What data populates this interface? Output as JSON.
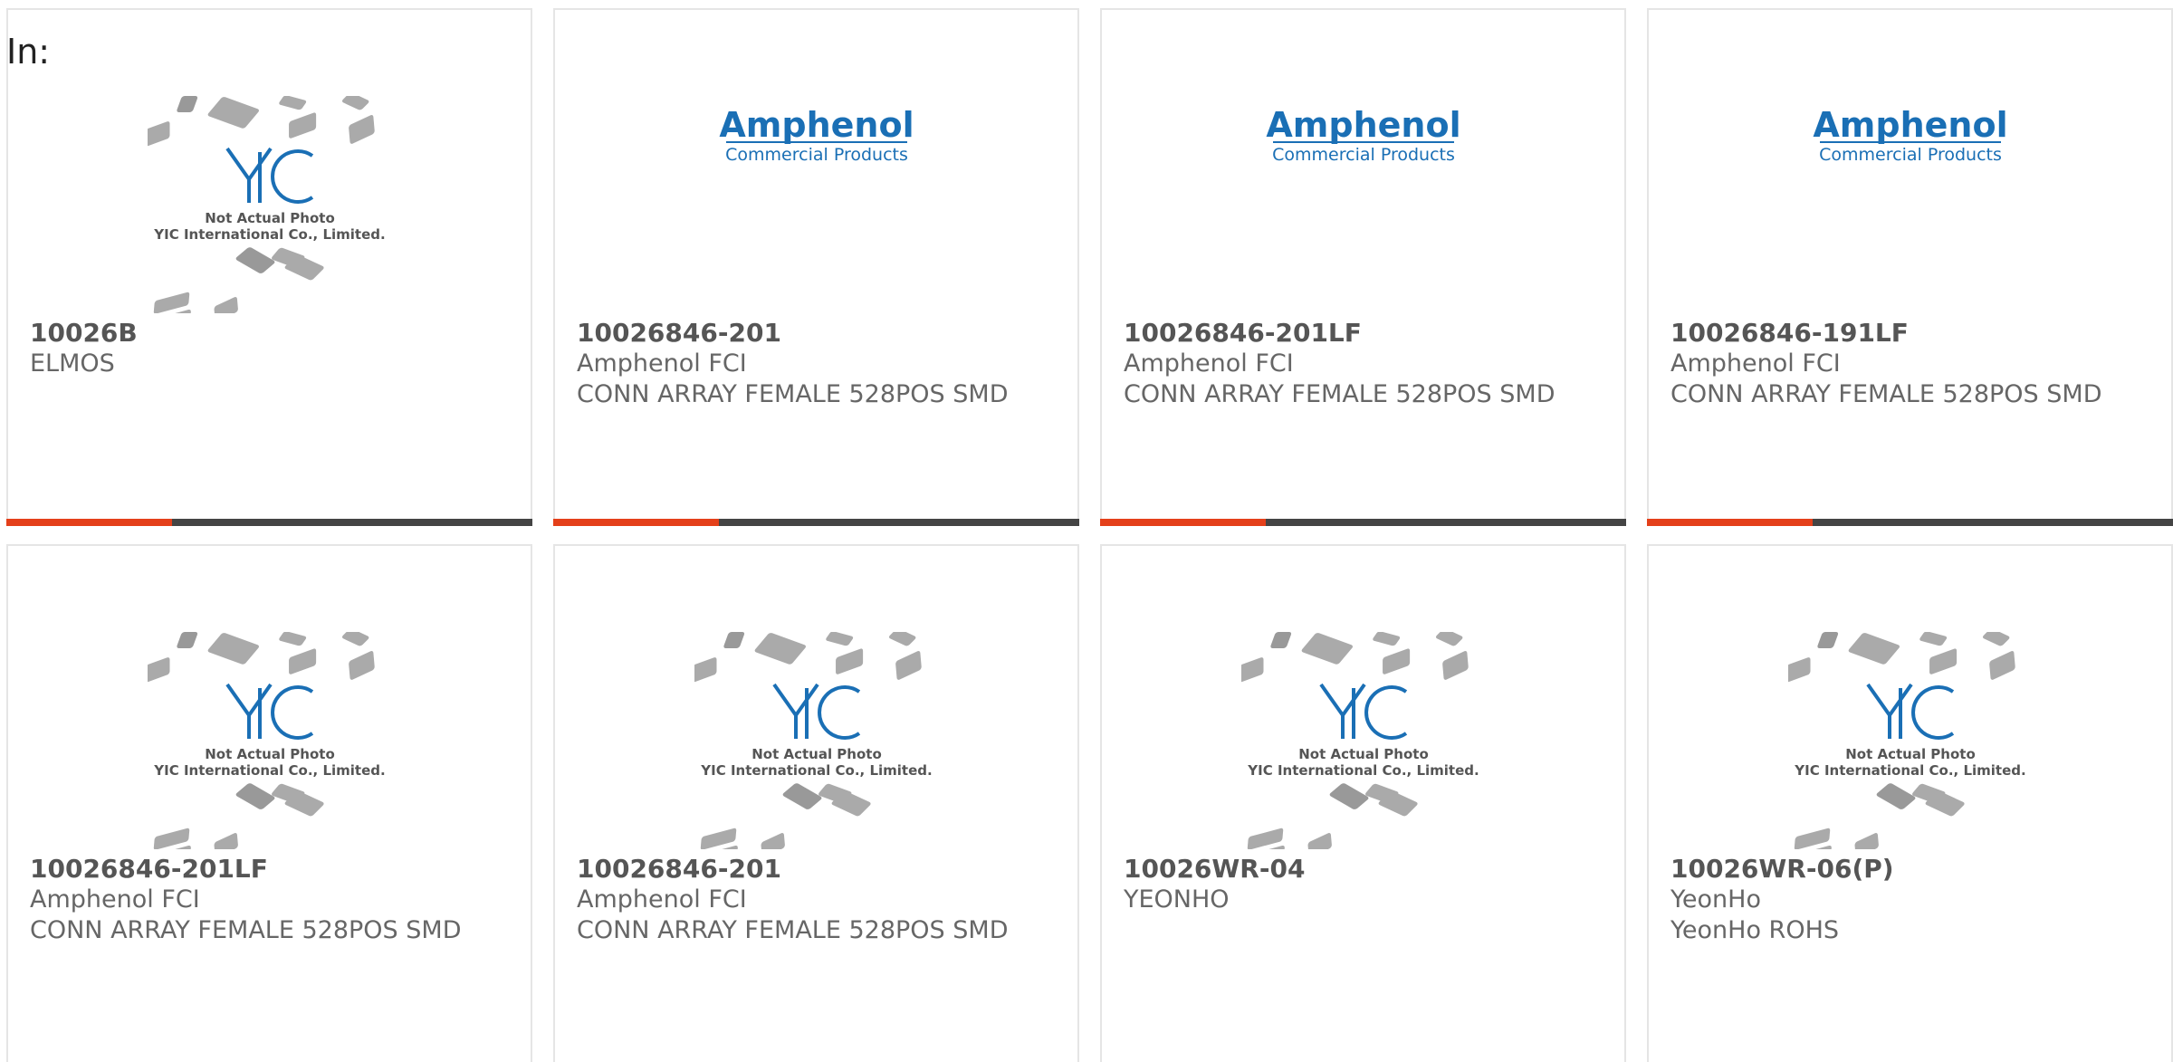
{
  "filter": {
    "label": "In:"
  },
  "colors": {
    "accent": "#e4401a",
    "bar": "#444444",
    "brand_blue": "#1a6fb5"
  },
  "products": [
    {
      "part": "10026B",
      "maker": "ELMOS",
      "desc": "",
      "image": "yic-placeholder",
      "image_text": [
        "Not Actual Photo",
        "YIC International Co., Limited."
      ]
    },
    {
      "part": "10026846-201",
      "maker": "Amphenol FCI",
      "desc": "CONN ARRAY FEMALE 528POS SMD",
      "image": "amphenol-logo",
      "image_text": [
        "Amphenol",
        "Commercial Products"
      ]
    },
    {
      "part": "10026846-201LF",
      "maker": "Amphenol FCI",
      "desc": "CONN ARRAY FEMALE 528POS SMD",
      "image": "amphenol-logo",
      "image_text": [
        "Amphenol",
        "Commercial Products"
      ]
    },
    {
      "part": "10026846-191LF",
      "maker": "Amphenol FCI",
      "desc": "CONN ARRAY FEMALE 528POS SMD",
      "image": "amphenol-logo",
      "image_text": [
        "Amphenol",
        "Commercial Products"
      ]
    },
    {
      "part": "10026846-201LF",
      "maker": "Amphenol FCI",
      "desc": "CONN ARRAY FEMALE 528POS SMD",
      "image": "yic-placeholder",
      "image_text": [
        "Not Actual Photo",
        "YIC International Co., Limited."
      ]
    },
    {
      "part": "10026846-201",
      "maker": "Amphenol FCI",
      "desc": "CONN ARRAY FEMALE 528POS SMD",
      "image": "yic-placeholder",
      "image_text": [
        "Not Actual Photo",
        "YIC International Co., Limited."
      ]
    },
    {
      "part": "10026WR-04",
      "maker": "YEONHO",
      "desc": "",
      "image": "yic-placeholder",
      "image_text": [
        "Not Actual Photo",
        "YIC International Co., Limited."
      ]
    },
    {
      "part": "10026WR-06(P)",
      "maker": "YeonHo",
      "desc": "YeonHo ROHS",
      "image": "yic-placeholder",
      "image_text": [
        "Not Actual Photo",
        "YIC International Co., Limited."
      ]
    }
  ]
}
